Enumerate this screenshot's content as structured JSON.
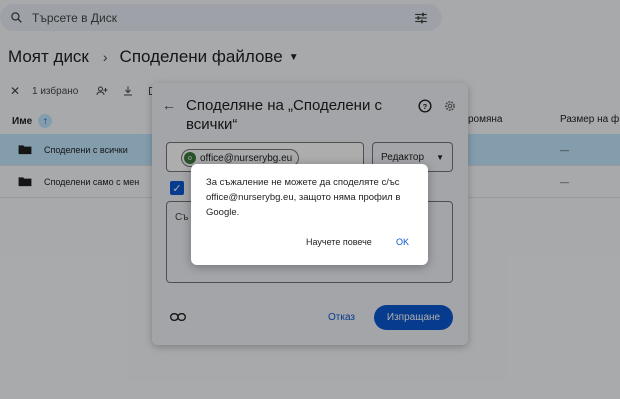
{
  "search": {
    "text": "Търсете в Диск"
  },
  "breadcrumbs": {
    "root": "Моят диск",
    "separator": "›",
    "current": "Споделени файлове"
  },
  "selection": {
    "count_label": "1 избрано"
  },
  "table": {
    "col_name": "Име",
    "col_modified": "ромяна",
    "col_size": "Размер на ф",
    "rows": [
      {
        "name": "Споделени с всички",
        "size": "—",
        "selected": true
      },
      {
        "name": "Споделени само с мен",
        "size": "—",
        "selected": false
      }
    ]
  },
  "share_dialog": {
    "title": "Споделяне на „Споделени с всички“",
    "chip_email": "office@nurserybg.eu",
    "role": "Редактор",
    "message_placeholder": "Съ",
    "cancel_label": "Отказ",
    "send_label": "Изпращане"
  },
  "alert": {
    "text": "За съжаление не можете да споделяте с/ъс office@nurserybg.eu, защото няма профил в Google.",
    "learn_more": "Научете повече",
    "ok": "OK"
  },
  "colors": {
    "accent": "#0b57d0",
    "selected_row": "#c2e7ff"
  }
}
